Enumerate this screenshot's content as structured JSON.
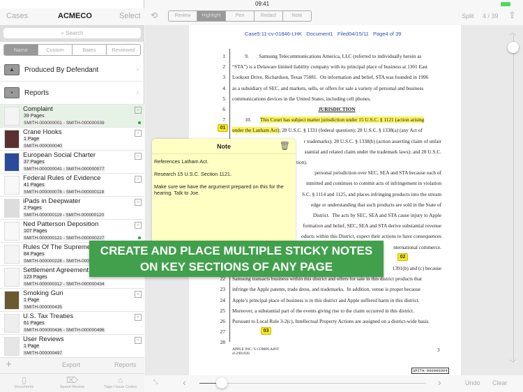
{
  "status": {
    "time": "09:41"
  },
  "sidebar": {
    "nav": {
      "back": "Cases",
      "title": "ACMECO",
      "select": "Select"
    },
    "search_placeholder": "Search",
    "sort": [
      "Name",
      "Custom",
      "Bates",
      "Reviewed"
    ],
    "sort_active": "Name",
    "folders": [
      {
        "label": "Produced By Defendant",
        "icon": "warning-triangle-icon"
      },
      {
        "label": "Reports",
        "icon": "document-icon"
      }
    ],
    "documents": [
      {
        "title": "Complaint",
        "pages": "39 Pages",
        "bates": "SMITH-000000001 - SMITH-000000039",
        "dot": true,
        "selected": true
      },
      {
        "title": "Crane Hooks",
        "pages": "1 Page",
        "bates": "SMITH-000000040",
        "dot": false
      },
      {
        "title": "European Social Charter",
        "pages": "37 Pages",
        "bates": "SMITH-000000041 - SMITH-000000077",
        "dot": false
      },
      {
        "title": "Federal Rules of Evidence",
        "pages": "41 Pages",
        "bates": "SMITH-000000078 - SMITH-000000118",
        "dot": false
      },
      {
        "title": "iPads in Deepwater",
        "pages": "2 Pages",
        "bates": "SMITH-000000119 - SMITH-000000120",
        "dot": false
      },
      {
        "title": "Ned Patterson Deposition",
        "pages": "107 Pages",
        "bates": "SMITH-000000121 - SMITH-000000227",
        "dot": true
      },
      {
        "title": "Rules Of The Supreme",
        "pages": "84 Pages",
        "bates": "SMITH-000000228 - SMITH-000",
        "dot": false
      },
      {
        "title": "Settlement Agreement",
        "pages": "123 Pages",
        "bates": "SMITH-000000312 - SMITH-000000434",
        "dot": false
      },
      {
        "title": "Smoking Gun",
        "pages": "1 Page",
        "bates": "SMITH-000000435",
        "dot": false
      },
      {
        "title": "U.S. Tax Treaties",
        "pages": "61 Pages",
        "bates": "SMITH-000000436 - SMITH-000000496",
        "dot": false
      },
      {
        "title": "User Reviews",
        "pages": "1 Page",
        "bates": "SMITH-000000497",
        "dot": false
      }
    ],
    "toolbar": {
      "add": "+",
      "export": "Export",
      "reports": "Reports"
    },
    "tabs": [
      "Documents",
      "Speed Review",
      "Tags / Issue Codes"
    ]
  },
  "toolbar": {
    "modes": [
      "Review",
      "Highlight",
      "Pen",
      "Redact",
      "Note"
    ],
    "active": "Highlight",
    "split": "Split",
    "page_counter": "4 / 39"
  },
  "document": {
    "header": "Case5:11-cv-01846-LHK   Document1   Filed04/15/11   Page4 of 39",
    "lines": [
      {
        "n": "1",
        "t": "          9.        Samsung Telecommunications America, LLC (referred to individually herein as"
      },
      {
        "n": "2",
        "t": "“STA”) is a Delaware limited liability company with its principal place of business at 1301 East"
      },
      {
        "n": "3",
        "t": "Lookout Drive, Richardson, Texas 75081.  On information and belief, STA was founded in 1996"
      },
      {
        "n": "4",
        "t": "as a subsidiary of SEC, and markets, sells, or offers for sale a variety of personal and business"
      },
      {
        "n": "5",
        "t": "communications devices in the United States, including cell phones."
      },
      {
        "n": "6",
        "t": "JURISDICTION",
        "heading": true
      },
      {
        "n": "7",
        "t": "          10.       ",
        "hl": "This Court has subject matter jurisdiction under 15 U.S.C. § 1121 (action arising"
      },
      {
        "n": "",
        "hl": "under the Lanham Act)",
        "t": "; 28 U.S.C. § 1331 (federal question); 28 U.S.C. § 1338(a) (any Act of"
      },
      {
        "n": "",
        "t": "r trademarks); 28 U.S.C. § 1338(b) (action asserting claim of unfair",
        "r": true
      },
      {
        "n": "",
        "t": "stantial and related claim under the trademark laws); and 28 U.S.C.",
        "r": true
      },
      {
        "n": "",
        "t": "tion).",
        "frag": true
      },
      {
        "n": "",
        "t": "personal jurisdiction over SEC, SEA and STA because each of",
        "r": true
      },
      {
        "n": "",
        "t": "mmitted and continues to commit acts of infringement in violation",
        "r": true
      },
      {
        "n": "",
        "t": "S.C. § 1114 and 1125, and places infringing products into the stream",
        "r": true
      },
      {
        "n": "",
        "t": "edge or understanding that such products are sold in the State of",
        "r": true
      },
      {
        "n": "",
        "t": "District.  The acts by SEC, SEA and STA cause injury to Apple",
        "r": true
      },
      {
        "n": "",
        "t": "formation and belief, SEC, SEA and STA derive substantial revenue",
        "r": true
      },
      {
        "n": "",
        "t": "oducts within this District, expect their actions to have consequences",
        "r": true
      },
      {
        "n": "",
        "t": "nternational commerce.",
        "r": true
      },
      {
        "n": "",
        "t": "NT",
        "frag2": true
      },
      {
        "n": "",
        "t": "1391(b) and (c) because",
        "r": true
      },
      {
        "n": "22",
        "t": "Samsung transacts business within this district and offers for sale in this district products that"
      },
      {
        "n": "23",
        "t": "infringe the Apple patents, trade dress, and trademarks.  In addition, venue is proper because"
      },
      {
        "n": "24",
        "t": "Apple’s principal place of business is in this district and Apple suffered harm in this district."
      },
      {
        "n": "25",
        "t": "Moreover, a substantial part of the events giving rise to the claim occurred in this district."
      },
      {
        "n": "26",
        "t": "Pursuant to Local Rule 3-2(c), Intellectual Property Actions are assigned on a district-wide basis."
      },
      {
        "n": "27",
        "t": ""
      },
      {
        "n": "28",
        "t": ""
      }
    ],
    "markers": [
      "01",
      "02",
      "03"
    ],
    "footer_title": "APPLE INC.’S COMPLAINT",
    "footer_id": "sf-2981926",
    "page_number": "3",
    "bates_stamp": "SMITH-000000004"
  },
  "note": {
    "title": "Note",
    "paragraphs": [
      "References Latham Act.",
      "Research 15 U.S.C. Section 1121.",
      "Make sure we have the argument prepared on this for the hearing. Talk to Joe."
    ]
  },
  "banner": {
    "line1": "CREATE AND PLACE MULTIPLE STICKY NOTES",
    "line2": "ON KEY SECTIONS OF ANY PAGE"
  },
  "bottom": {
    "undo": "Undo",
    "clear": "Clear",
    "page_slider_fraction": 0.1,
    "vertical_slider_fraction": 0.05
  },
  "colors": {
    "accent_green": "#41a04b",
    "highlight": "#fbf35a",
    "link_blue": "#2b4fb5"
  }
}
